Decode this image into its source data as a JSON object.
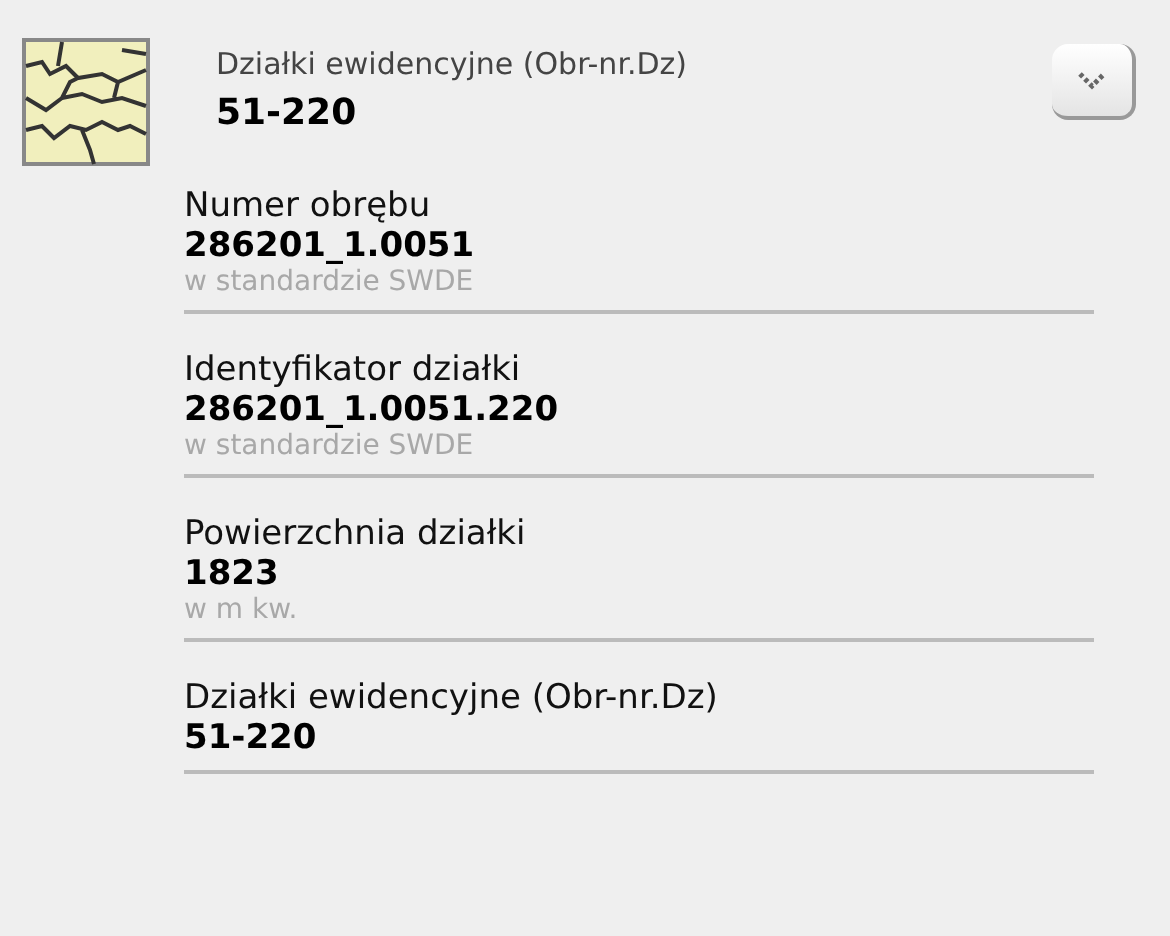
{
  "header": {
    "subtitle": "Działki ewidencyjne (Obr-nr.Dz)",
    "title": "51-220"
  },
  "fields": [
    {
      "label": "Numer obrębu",
      "value": "286201_1.0051",
      "note": "w standardzie SWDE"
    },
    {
      "label": "Identyfikator działki",
      "value": "286201_1.0051.220",
      "note": "w standardzie SWDE"
    },
    {
      "label": "Powierzchnia działki",
      "value": "1823",
      "note": "w m kw."
    },
    {
      "label": "Działki ewidencyjne (Obr-nr.Dz)",
      "value": "51-220"
    }
  ]
}
